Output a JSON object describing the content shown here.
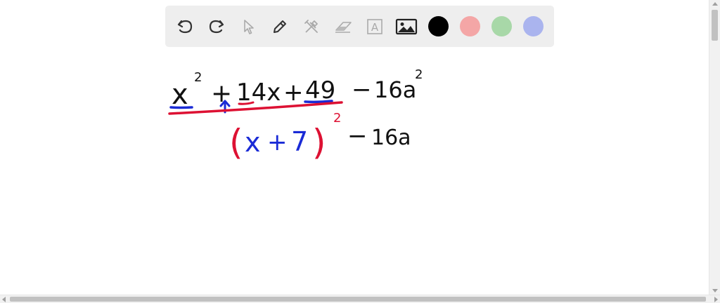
{
  "toolbar": {
    "tools": [
      {
        "name": "undo-icon"
      },
      {
        "name": "redo-icon"
      },
      {
        "name": "select-arrow-icon"
      },
      {
        "name": "pen-icon"
      },
      {
        "name": "tools-icon"
      },
      {
        "name": "eraser-icon"
      },
      {
        "name": "text-icon",
        "glyph": "A"
      },
      {
        "name": "image-icon"
      }
    ],
    "colors": [
      {
        "name": "black",
        "hex": "#000000"
      },
      {
        "name": "red",
        "hex": "#f4a6a6"
      },
      {
        "name": "green",
        "hex": "#a8d8a8"
      },
      {
        "name": "blue",
        "hex": "#aab4ee"
      }
    ]
  },
  "whiteboard": {
    "ink_colors": {
      "black": "#111111",
      "red": "#dd1133",
      "blue": "#1a2bd6"
    },
    "line1": {
      "x": "x",
      "exp1": "2",
      "plus1": "+",
      "coef": "14x",
      "plus2": "+",
      "const": "49",
      "minus": "−",
      "term": "16a",
      "exp2": "2"
    },
    "line2": {
      "open_paren": "(",
      "x": "x",
      "plus": "+",
      "seven": "7",
      "close_paren": ")",
      "exp": "2",
      "minus": "−",
      "term": "16a"
    }
  }
}
